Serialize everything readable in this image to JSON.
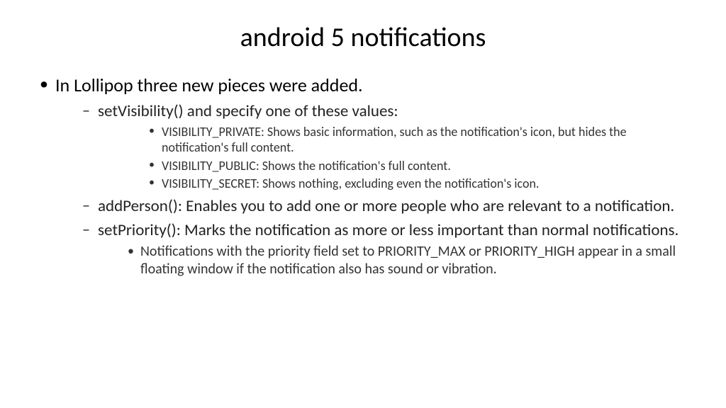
{
  "title": "android 5 notifications",
  "bullet1": "In Lollipop three new pieces were added.",
  "sub1": "setVisibility() and specify one of these values:",
  "vis_private": "VISIBILITY_PRIVATE: Shows basic information, such as the notification's icon, but hides the notification's full content.",
  "vis_public": "VISIBILITY_PUBLIC: Shows the notification's full content.",
  "vis_secret": "VISIBILITY_SECRET: Shows nothing, excluding even the notification's icon.",
  "sub2": "addPerson(): Enables you to add one or more people who are relevant to a notification.",
  "sub3": "setPriority(): Marks the notification as more or less important than normal notifications.",
  "priority_note": "Notifications with the priority field set to PRIORITY_MAX or PRIORITY_HIGH appear in a small floating window if the notification also has sound or vibration."
}
